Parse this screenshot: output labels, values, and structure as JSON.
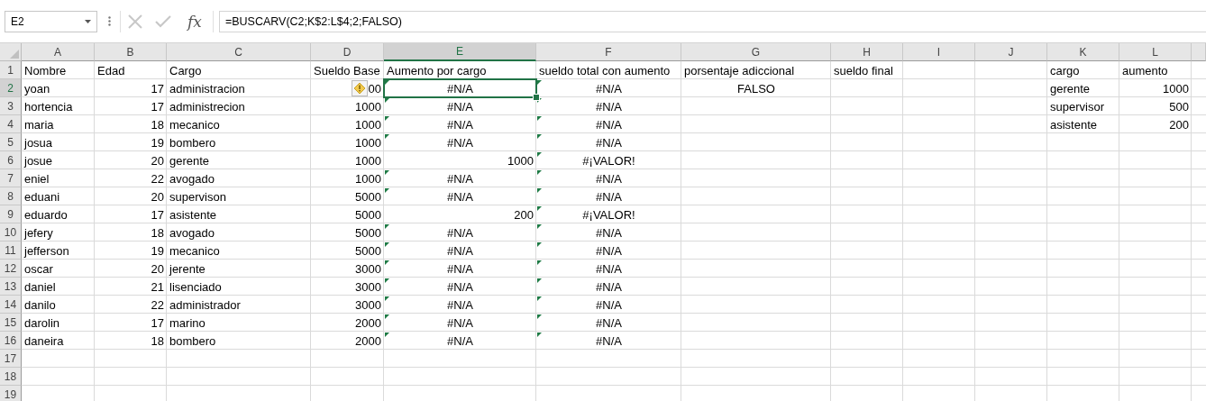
{
  "formula_bar": {
    "name_box": "E2",
    "function_label": "fx",
    "formula": "=BUSCARV(C2;K$2:L$4;2;FALSO)"
  },
  "columns": [
    {
      "label": "A",
      "selected": false
    },
    {
      "label": "B",
      "selected": false
    },
    {
      "label": "C",
      "selected": false
    },
    {
      "label": "D",
      "selected": false
    },
    {
      "label": "E",
      "selected": true
    },
    {
      "label": "F",
      "selected": false
    },
    {
      "label": "G",
      "selected": false
    },
    {
      "label": "H",
      "selected": false
    },
    {
      "label": "I",
      "selected": false
    },
    {
      "label": "J",
      "selected": false
    },
    {
      "label": "K",
      "selected": false
    },
    {
      "label": "L",
      "selected": false
    }
  ],
  "rows": [
    {
      "label": "1",
      "selected": false,
      "cells": [
        {
          "value": "Nombre",
          "kind": "text",
          "flag": false,
          "selected": false
        },
        {
          "value": "Edad",
          "kind": "text",
          "flag": false,
          "selected": false
        },
        {
          "value": "Cargo",
          "kind": "text",
          "flag": false,
          "selected": false
        },
        {
          "value": "Sueldo Base",
          "kind": "text",
          "flag": false,
          "selected": false
        },
        {
          "value": "Aumento por cargo",
          "kind": "text",
          "flag": false,
          "selected": false
        },
        {
          "value": "sueldo total con aumento",
          "kind": "text",
          "flag": false,
          "selected": false
        },
        {
          "value": "porsentaje adiccional",
          "kind": "text",
          "flag": false,
          "selected": false
        },
        {
          "value": "sueldo final",
          "kind": "text",
          "flag": false,
          "selected": false
        },
        null,
        null,
        {
          "value": "cargo",
          "kind": "text",
          "flag": false,
          "selected": false
        },
        {
          "value": "aumento",
          "kind": "text",
          "flag": false,
          "selected": false
        }
      ]
    },
    {
      "label": "2",
      "selected": true,
      "cells": [
        {
          "value": "yoan",
          "kind": "text",
          "flag": false,
          "selected": false
        },
        {
          "value": "17",
          "kind": "number",
          "flag": false,
          "selected": false
        },
        {
          "value": "administracion",
          "kind": "text",
          "flag": false,
          "selected": false
        },
        {
          "value": "00",
          "kind": "number",
          "flag": false,
          "selected": false,
          "warning": true
        },
        {
          "value": "#N/A",
          "kind": "error",
          "flag": true,
          "selected": true
        },
        {
          "value": "#N/A",
          "kind": "error",
          "flag": true,
          "selected": false
        },
        {
          "value": "FALSO",
          "kind": "logical",
          "flag": false,
          "selected": false
        },
        null,
        null,
        null,
        {
          "value": "gerente",
          "kind": "text",
          "flag": false,
          "selected": false
        },
        {
          "value": "1000",
          "kind": "number",
          "flag": false,
          "selected": false
        }
      ]
    },
    {
      "label": "3",
      "selected": false,
      "cells": [
        {
          "value": "hortencia",
          "kind": "text",
          "flag": false,
          "selected": false
        },
        {
          "value": "17",
          "kind": "number",
          "flag": false,
          "selected": false
        },
        {
          "value": "administrecion",
          "kind": "text",
          "flag": false,
          "selected": false
        },
        {
          "value": "1000",
          "kind": "number",
          "flag": false,
          "selected": false
        },
        {
          "value": "#N/A",
          "kind": "error",
          "flag": true,
          "selected": false
        },
        {
          "value": "#N/A",
          "kind": "error",
          "flag": true,
          "selected": false
        },
        null,
        null,
        null,
        null,
        {
          "value": "supervisor",
          "kind": "text",
          "flag": false,
          "selected": false
        },
        {
          "value": "500",
          "kind": "number",
          "flag": false,
          "selected": false
        }
      ]
    },
    {
      "label": "4",
      "selected": false,
      "cells": [
        {
          "value": "maria",
          "kind": "text",
          "flag": false,
          "selected": false
        },
        {
          "value": "18",
          "kind": "number",
          "flag": false,
          "selected": false
        },
        {
          "value": "mecanico",
          "kind": "text",
          "flag": false,
          "selected": false
        },
        {
          "value": "1000",
          "kind": "number",
          "flag": false,
          "selected": false
        },
        {
          "value": "#N/A",
          "kind": "error",
          "flag": true,
          "selected": false
        },
        {
          "value": "#N/A",
          "kind": "error",
          "flag": true,
          "selected": false
        },
        null,
        null,
        null,
        null,
        {
          "value": "asistente",
          "kind": "text",
          "flag": false,
          "selected": false
        },
        {
          "value": "200",
          "kind": "number",
          "flag": false,
          "selected": false
        }
      ]
    },
    {
      "label": "5",
      "selected": false,
      "cells": [
        {
          "value": "josua",
          "kind": "text",
          "flag": false,
          "selected": false
        },
        {
          "value": "19",
          "kind": "number",
          "flag": false,
          "selected": false
        },
        {
          "value": "bombero",
          "kind": "text",
          "flag": false,
          "selected": false
        },
        {
          "value": "1000",
          "kind": "number",
          "flag": false,
          "selected": false
        },
        {
          "value": "#N/A",
          "kind": "error",
          "flag": true,
          "selected": false
        },
        {
          "value": "#N/A",
          "kind": "error",
          "flag": true,
          "selected": false
        }
      ]
    },
    {
      "label": "6",
      "selected": false,
      "cells": [
        {
          "value": "josue",
          "kind": "text",
          "flag": false,
          "selected": false
        },
        {
          "value": "20",
          "kind": "number",
          "flag": false,
          "selected": false
        },
        {
          "value": "gerente",
          "kind": "text",
          "flag": false,
          "selected": false
        },
        {
          "value": "1000",
          "kind": "number",
          "flag": false,
          "selected": false
        },
        {
          "value": "1000",
          "kind": "number",
          "flag": false,
          "selected": false
        },
        {
          "value": "#¡VALOR!",
          "kind": "error",
          "flag": true,
          "selected": false
        }
      ]
    },
    {
      "label": "7",
      "selected": false,
      "cells": [
        {
          "value": "eniel",
          "kind": "text",
          "flag": false,
          "selected": false
        },
        {
          "value": "22",
          "kind": "number",
          "flag": false,
          "selected": false
        },
        {
          "value": "avogado",
          "kind": "text",
          "flag": false,
          "selected": false
        },
        {
          "value": "1000",
          "kind": "number",
          "flag": false,
          "selected": false
        },
        {
          "value": "#N/A",
          "kind": "error",
          "flag": true,
          "selected": false
        },
        {
          "value": "#N/A",
          "kind": "error",
          "flag": true,
          "selected": false
        }
      ]
    },
    {
      "label": "8",
      "selected": false,
      "cells": [
        {
          "value": "eduani",
          "kind": "text",
          "flag": false,
          "selected": false
        },
        {
          "value": "20",
          "kind": "number",
          "flag": false,
          "selected": false
        },
        {
          "value": "supervison",
          "kind": "text",
          "flag": false,
          "selected": false
        },
        {
          "value": "5000",
          "kind": "number",
          "flag": false,
          "selected": false
        },
        {
          "value": "#N/A",
          "kind": "error",
          "flag": true,
          "selected": false
        },
        {
          "value": "#N/A",
          "kind": "error",
          "flag": true,
          "selected": false
        }
      ]
    },
    {
      "label": "9",
      "selected": false,
      "cells": [
        {
          "value": "eduardo",
          "kind": "text",
          "flag": false,
          "selected": false
        },
        {
          "value": "17",
          "kind": "number",
          "flag": false,
          "selected": false
        },
        {
          "value": "asistente",
          "kind": "text",
          "flag": false,
          "selected": false
        },
        {
          "value": "5000",
          "kind": "number",
          "flag": false,
          "selected": false
        },
        {
          "value": "200",
          "kind": "number",
          "flag": false,
          "selected": false
        },
        {
          "value": "#¡VALOR!",
          "kind": "error",
          "flag": true,
          "selected": false
        }
      ]
    },
    {
      "label": "10",
      "selected": false,
      "cells": [
        {
          "value": "jefery",
          "kind": "text",
          "flag": false,
          "selected": false
        },
        {
          "value": "18",
          "kind": "number",
          "flag": false,
          "selected": false
        },
        {
          "value": "avogado",
          "kind": "text",
          "flag": false,
          "selected": false
        },
        {
          "value": "5000",
          "kind": "number",
          "flag": false,
          "selected": false
        },
        {
          "value": "#N/A",
          "kind": "error",
          "flag": true,
          "selected": false
        },
        {
          "value": "#N/A",
          "kind": "error",
          "flag": true,
          "selected": false
        }
      ]
    },
    {
      "label": "11",
      "selected": false,
      "cells": [
        {
          "value": "jefferson",
          "kind": "text",
          "flag": false,
          "selected": false
        },
        {
          "value": "19",
          "kind": "number",
          "flag": false,
          "selected": false
        },
        {
          "value": "mecanico",
          "kind": "text",
          "flag": false,
          "selected": false
        },
        {
          "value": "5000",
          "kind": "number",
          "flag": false,
          "selected": false
        },
        {
          "value": "#N/A",
          "kind": "error",
          "flag": true,
          "selected": false
        },
        {
          "value": "#N/A",
          "kind": "error",
          "flag": true,
          "selected": false
        }
      ]
    },
    {
      "label": "12",
      "selected": false,
      "cells": [
        {
          "value": "oscar",
          "kind": "text",
          "flag": false,
          "selected": false
        },
        {
          "value": "20",
          "kind": "number",
          "flag": false,
          "selected": false
        },
        {
          "value": "jerente",
          "kind": "text",
          "flag": false,
          "selected": false
        },
        {
          "value": "3000",
          "kind": "number",
          "flag": false,
          "selected": false
        },
        {
          "value": "#N/A",
          "kind": "error",
          "flag": true,
          "selected": false
        },
        {
          "value": "#N/A",
          "kind": "error",
          "flag": true,
          "selected": false
        }
      ]
    },
    {
      "label": "13",
      "selected": false,
      "cells": [
        {
          "value": "daniel",
          "kind": "text",
          "flag": false,
          "selected": false
        },
        {
          "value": "21",
          "kind": "number",
          "flag": false,
          "selected": false
        },
        {
          "value": "lisenciado",
          "kind": "text",
          "flag": false,
          "selected": false
        },
        {
          "value": "3000",
          "kind": "number",
          "flag": false,
          "selected": false
        },
        {
          "value": "#N/A",
          "kind": "error",
          "flag": true,
          "selected": false
        },
        {
          "value": "#N/A",
          "kind": "error",
          "flag": true,
          "selected": false
        }
      ]
    },
    {
      "label": "14",
      "selected": false,
      "cells": [
        {
          "value": "danilo",
          "kind": "text",
          "flag": false,
          "selected": false
        },
        {
          "value": "22",
          "kind": "number",
          "flag": false,
          "selected": false
        },
        {
          "value": "administrador",
          "kind": "text",
          "flag": false,
          "selected": false
        },
        {
          "value": "3000",
          "kind": "number",
          "flag": false,
          "selected": false
        },
        {
          "value": "#N/A",
          "kind": "error",
          "flag": true,
          "selected": false
        },
        {
          "value": "#N/A",
          "kind": "error",
          "flag": true,
          "selected": false
        }
      ]
    },
    {
      "label": "15",
      "selected": false,
      "cells": [
        {
          "value": "darolin",
          "kind": "text",
          "flag": false,
          "selected": false
        },
        {
          "value": "17",
          "kind": "number",
          "flag": false,
          "selected": false
        },
        {
          "value": "marino",
          "kind": "text",
          "flag": false,
          "selected": false
        },
        {
          "value": "2000",
          "kind": "number",
          "flag": false,
          "selected": false
        },
        {
          "value": "#N/A",
          "kind": "error",
          "flag": true,
          "selected": false
        },
        {
          "value": "#N/A",
          "kind": "error",
          "flag": true,
          "selected": false
        }
      ]
    },
    {
      "label": "16",
      "selected": false,
      "cells": [
        {
          "value": "daneira",
          "kind": "text",
          "flag": false,
          "selected": false
        },
        {
          "value": "18",
          "kind": "number",
          "flag": false,
          "selected": false
        },
        {
          "value": "bombero",
          "kind": "text",
          "flag": false,
          "selected": false
        },
        {
          "value": "2000",
          "kind": "number",
          "flag": false,
          "selected": false
        },
        {
          "value": "#N/A",
          "kind": "error",
          "flag": true,
          "selected": false
        },
        {
          "value": "#N/A",
          "kind": "error",
          "flag": true,
          "selected": false
        }
      ]
    },
    {
      "label": "17",
      "selected": false,
      "cells": []
    },
    {
      "label": "18",
      "selected": false,
      "cells": []
    },
    {
      "label": "19",
      "selected": false,
      "cells": []
    }
  ]
}
